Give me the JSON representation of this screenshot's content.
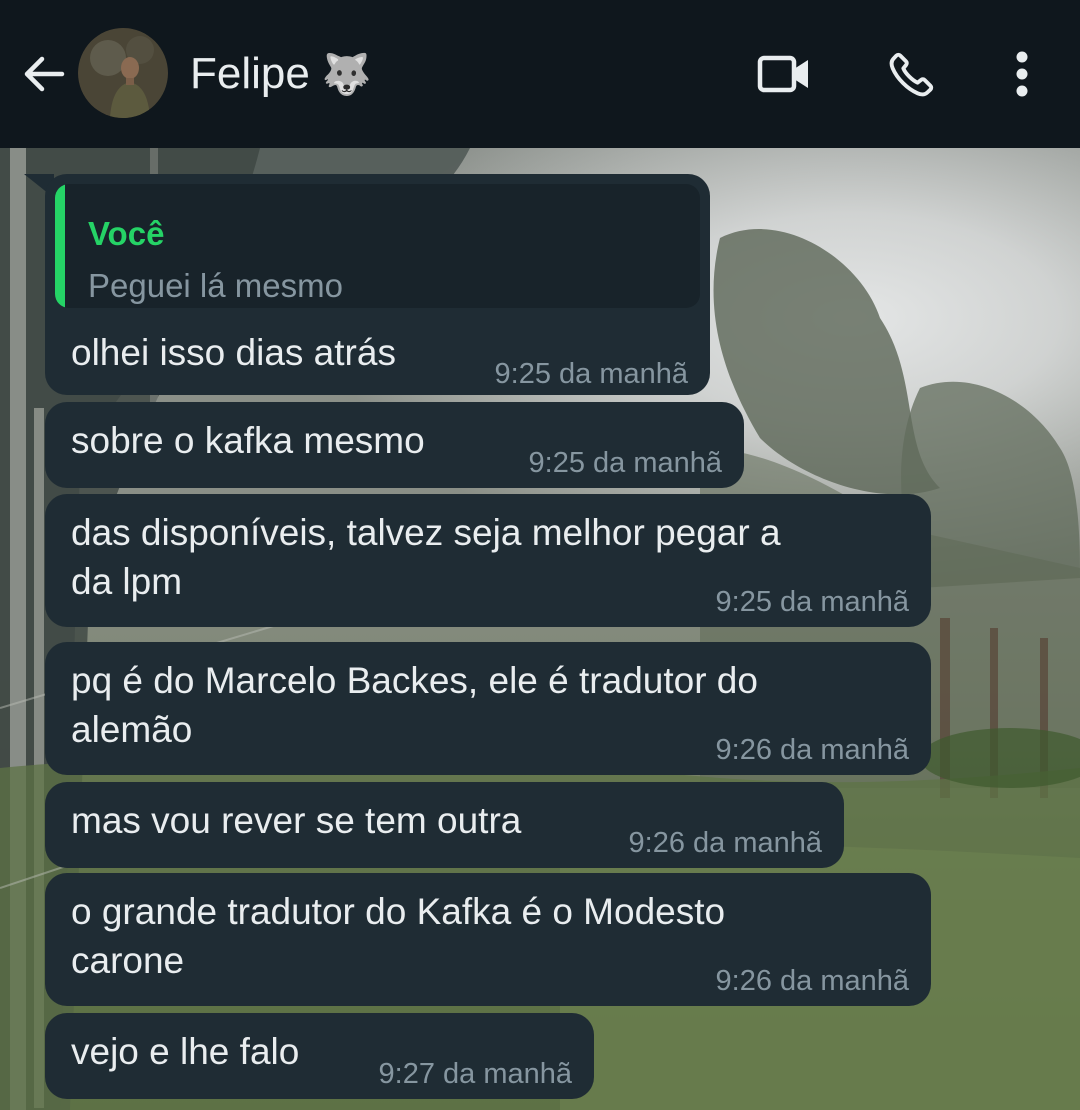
{
  "header": {
    "contact_name": "Felipe",
    "contact_emoji": "🐺",
    "icons": [
      "back-arrow-icon",
      "video-camera-icon",
      "phone-icon",
      "more-vertical-icon"
    ]
  },
  "colors": {
    "header_bg": "#0f171d",
    "bubble_bg": "#1f2c34",
    "quote_accent": "#25d366",
    "timestamp": "#8696a0",
    "text": "#e9edef"
  },
  "messages": [
    {
      "reply_to": {
        "author": "Você",
        "text": "Peguei lá mesmo"
      },
      "lines": [
        "olhei isso dias atrás"
      ],
      "time": "9:25 da manhã"
    },
    {
      "lines": [
        "sobre o kafka mesmo"
      ],
      "time": "9:25 da manhã"
    },
    {
      "lines": [
        "das disponíveis, talvez seja melhor pegar a",
        "da lpm"
      ],
      "time": "9:25 da manhã"
    },
    {
      "lines": [
        "pq é do Marcelo Backes, ele é tradutor do",
        "alemão"
      ],
      "time": "9:26 da manhã"
    },
    {
      "lines": [
        "mas vou rever se tem outra"
      ],
      "time": "9:26 da manhã"
    },
    {
      "lines": [
        "o grande tradutor do Kafka é o Modesto",
        "carone"
      ],
      "time": "9:26 da manhã"
    },
    {
      "lines": [
        "vejo e lhe falo"
      ],
      "time": "9:27 da manhã"
    }
  ]
}
